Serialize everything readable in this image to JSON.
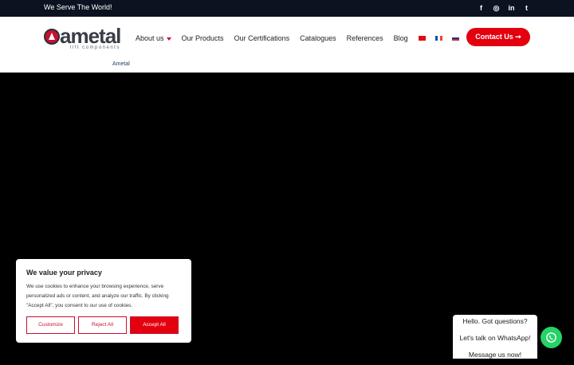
{
  "topbar": {
    "tagline": "We Serve The World!"
  },
  "social": [
    {
      "icon": "facebook-icon",
      "glyph": "f"
    },
    {
      "icon": "instagram-icon",
      "glyph": "◎"
    },
    {
      "icon": "linkedin-icon",
      "glyph": "in"
    },
    {
      "icon": "twitter-icon",
      "glyph": "t"
    }
  ],
  "logo": {
    "word": "ametal",
    "sub": "lift components"
  },
  "nav": {
    "about": "About us",
    "products": "Our Products",
    "certifications": "Our Certifications",
    "catalogues": "Catalogues",
    "references": "References",
    "blog": "Blog"
  },
  "contact": {
    "label": "Contact Us ➞"
  },
  "breadcrumb": "Ametal",
  "cookie": {
    "title": "We value your privacy",
    "text": "We use cookies to enhance your browsing experience, serve personalized ads or content, and analyze our traffic. By clicking \"Accept All\", you consent to our use of cookies.",
    "customize": "Customize",
    "reject": "Reject All",
    "accept": "Accept All"
  },
  "chat": {
    "line1": "Hello. Got questions?",
    "line2": "Let's talk on WhatsApp!",
    "line3": "Message us now!"
  },
  "colors": {
    "accent": "#e3000f",
    "topbar": "#0b1220",
    "whatsapp": "#25d366"
  }
}
